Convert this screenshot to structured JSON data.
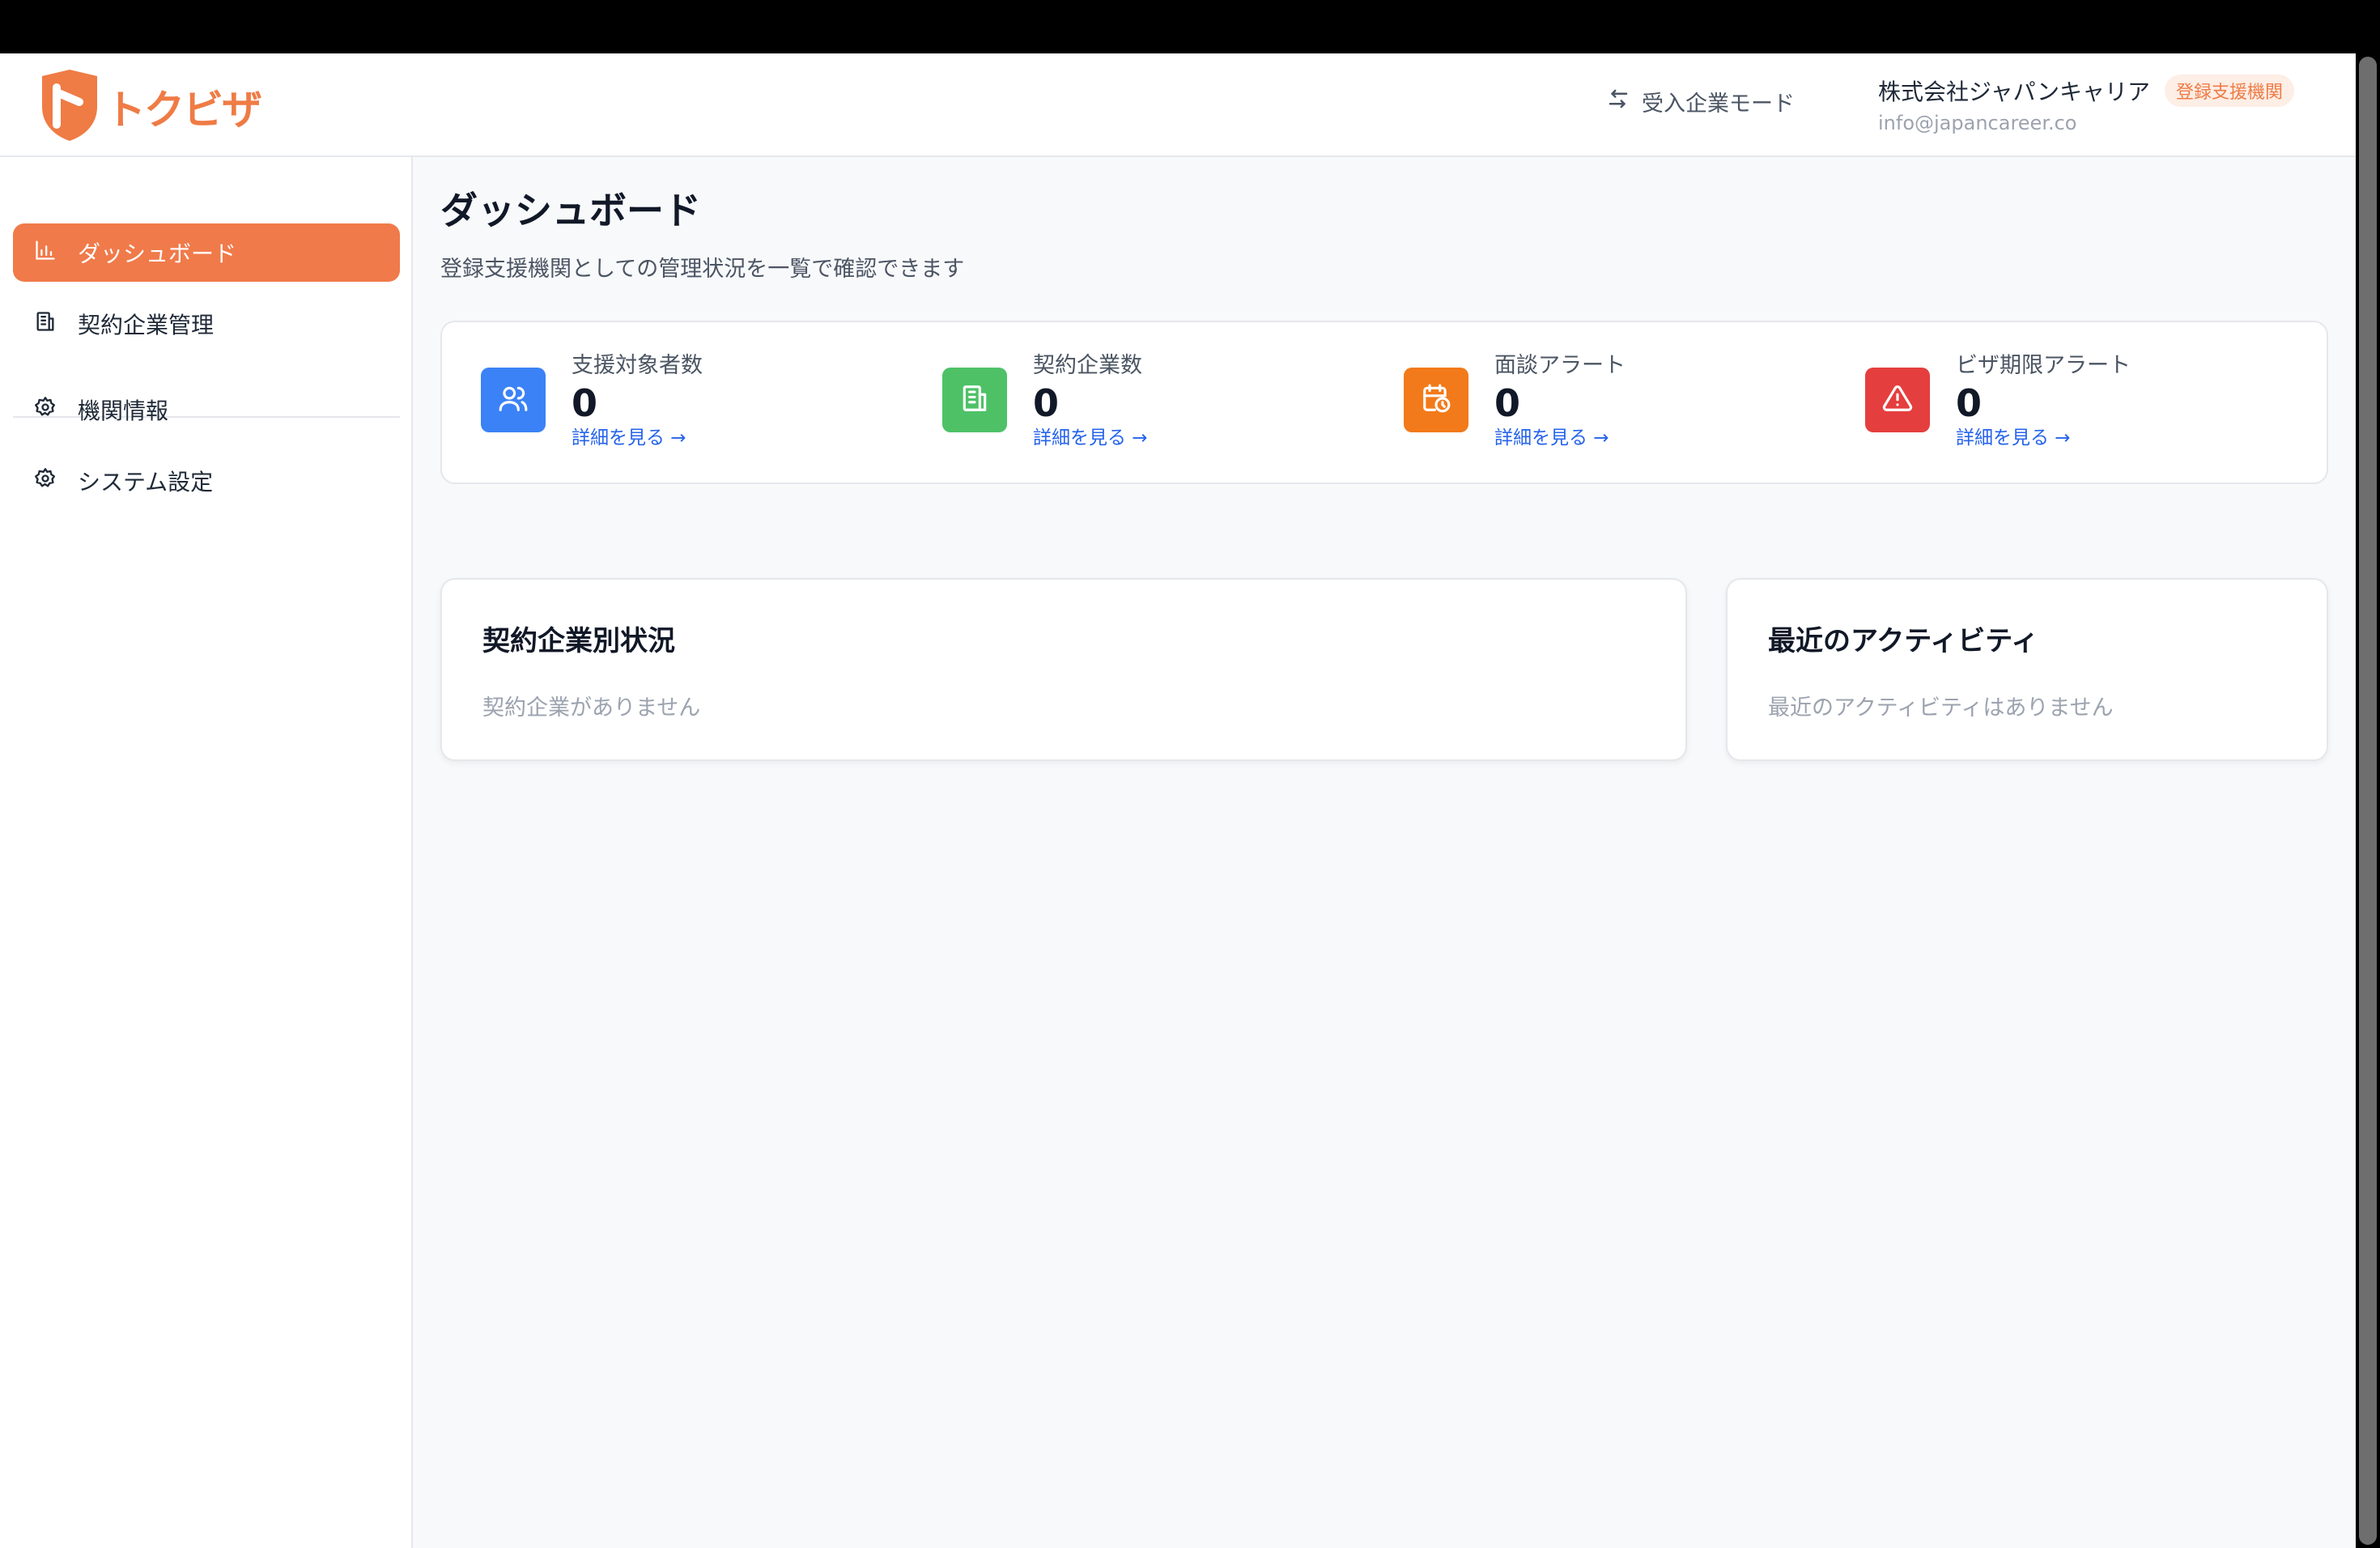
{
  "header": {
    "logo_text": "トクビザ",
    "mode_switch_label": "受入企業モード",
    "company_name": "株式会社ジャパンキャリア",
    "company_badge": "登録支援機関",
    "company_email": "info@japancareer.co"
  },
  "sidebar": {
    "items": [
      {
        "label": "ダッシュボード",
        "icon": "bar-chart-icon",
        "active": true
      },
      {
        "label": "契約企業管理",
        "icon": "building-icon",
        "active": false
      },
      {
        "label": "機関情報",
        "icon": "gear-icon",
        "active": false
      },
      {
        "label": "システム設定",
        "icon": "gear-icon",
        "active": false
      }
    ]
  },
  "main": {
    "title": "ダッシュボード",
    "subtitle": "登録支援機関としての管理状況を一覧で確認できます",
    "stats": [
      {
        "label": "支援対象者数",
        "value": "0",
        "link": "詳細を見る →",
        "icon": "users-icon",
        "color": "#3b82f6"
      },
      {
        "label": "契約企業数",
        "value": "0",
        "link": "詳細を見る →",
        "icon": "building-icon",
        "color": "#4ec167"
      },
      {
        "label": "面談アラート",
        "value": "0",
        "link": "詳細を見る →",
        "icon": "calendar-clock-icon",
        "color": "#f27a1a"
      },
      {
        "label": "ビザ期限アラート",
        "value": "0",
        "link": "詳細を見る →",
        "icon": "warning-icon",
        "color": "#e53e3e"
      }
    ],
    "company_status": {
      "title": "契約企業別状況",
      "empty_text": "契約企業がありません"
    },
    "recent_activity": {
      "title": "最近のアクティビティ",
      "empty_text": "最近のアクティビティはありません"
    }
  },
  "colors": {
    "accent": "#f07a4a",
    "link": "#2563eb"
  }
}
